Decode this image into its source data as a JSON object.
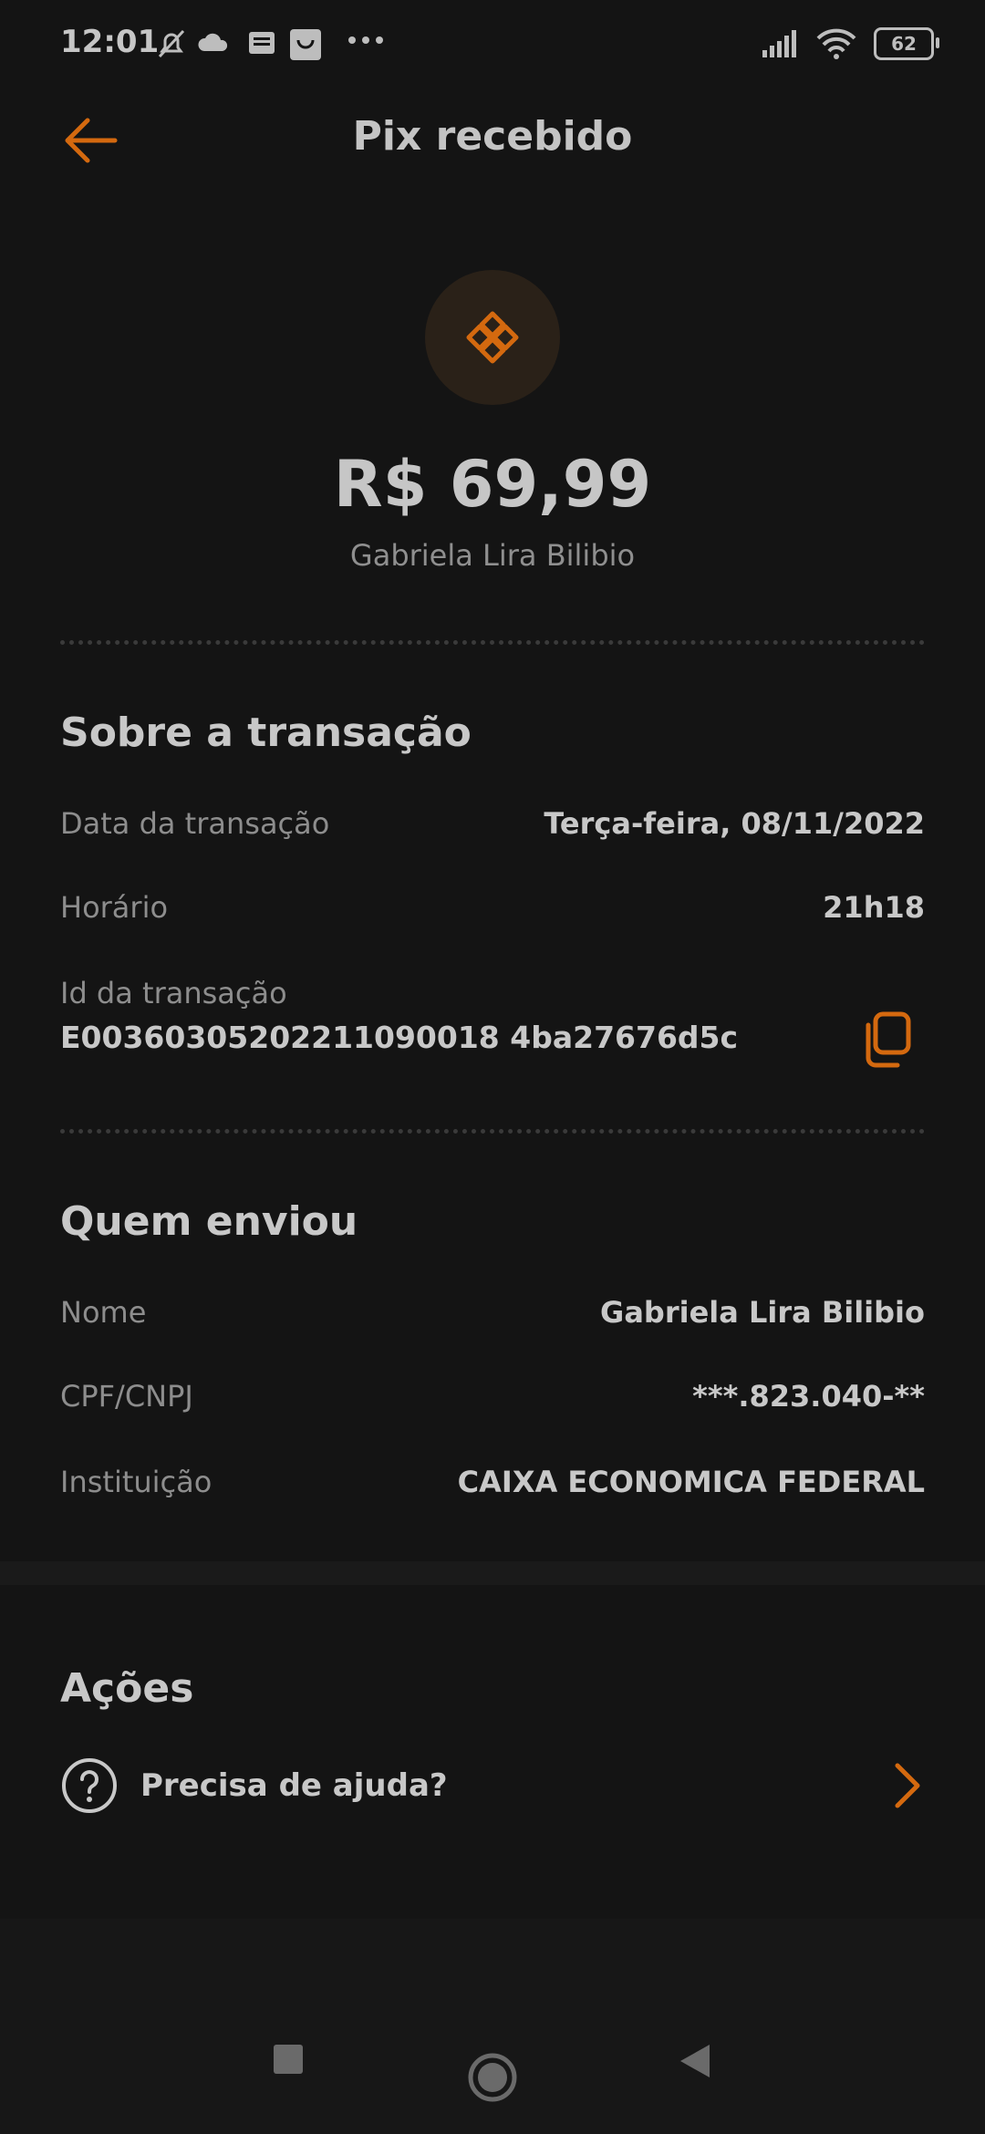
{
  "status_bar": {
    "time": "12:01",
    "battery": "62",
    "icons": [
      "bell-off-icon",
      "cloud-icon",
      "news-icon",
      "shop-icon",
      "more-dots-icon",
      "signal-icon",
      "wifi-icon",
      "battery-icon"
    ]
  },
  "header": {
    "title": "Pix recebido",
    "back_icon": "arrow-left-icon"
  },
  "hero": {
    "icon": "pix-icon",
    "amount": "R$ 69,99",
    "name": "Gabriela Lira Bilibio"
  },
  "transaction": {
    "title": "Sobre a transação",
    "rows": [
      {
        "label": "Data da transação",
        "value": "Terça-feira, 08/11/2022"
      },
      {
        "label": "Horário",
        "value": "21h18"
      }
    ],
    "id_label": "Id da transação",
    "id_value": "E00360305202211090018 4ba27676d5c"
  },
  "sender": {
    "title": "Quem enviou",
    "rows": [
      {
        "label": "Nome",
        "value": "Gabriela Lira Bilibio"
      },
      {
        "label": "CPF/CNPJ",
        "value": "***.823.040-**"
      },
      {
        "label": "Instituição",
        "value": "CAIXA ECONOMICA FEDERAL"
      }
    ]
  },
  "actions": {
    "title": "Ações",
    "help_label": "Precisa de ajuda?"
  },
  "colors": {
    "accent": "#d4690f",
    "background": "#141414",
    "text_primary": "#c8c8c8",
    "text_secondary": "#8d8d8d"
  }
}
